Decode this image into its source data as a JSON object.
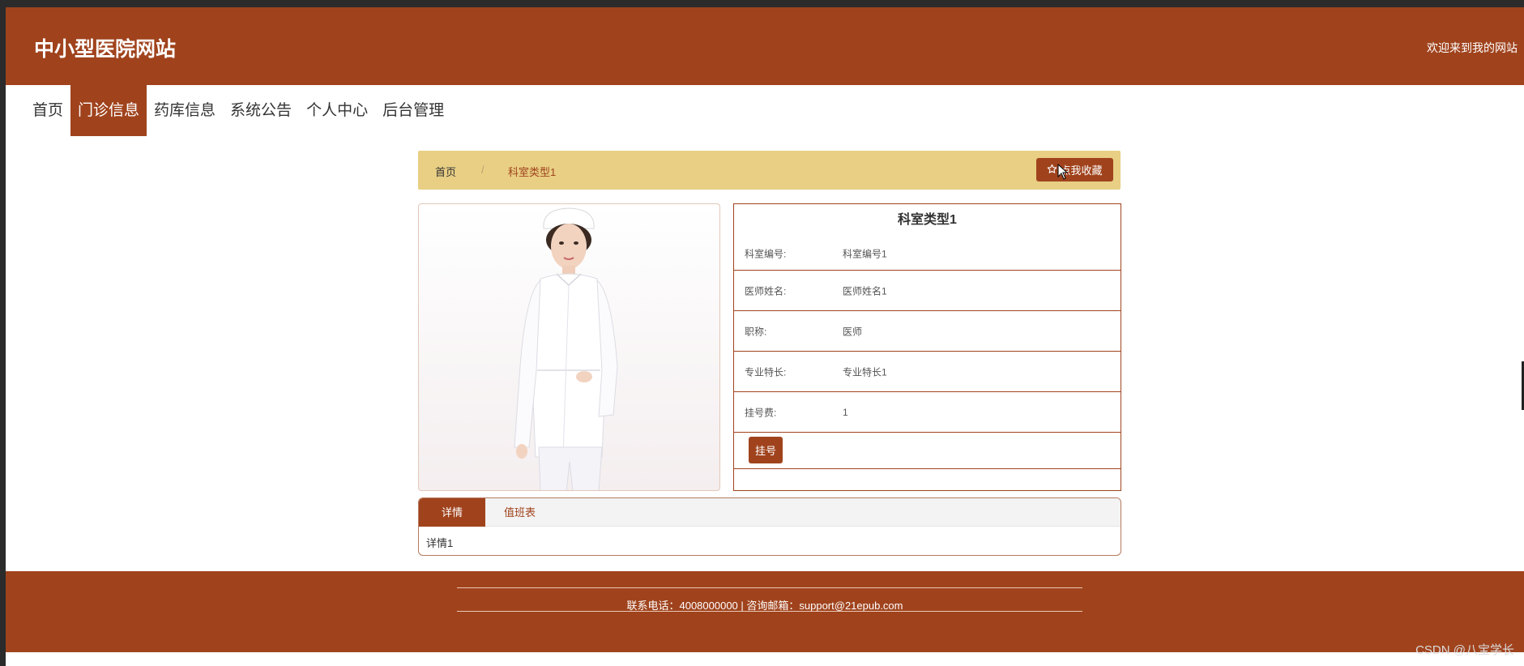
{
  "header": {
    "site_title": "中小型医院网站",
    "welcome_text": "欢迎来到我的网站"
  },
  "nav": {
    "items": [
      {
        "label": "首页"
      },
      {
        "label": "门诊信息"
      },
      {
        "label": "药库信息"
      },
      {
        "label": "系统公告"
      },
      {
        "label": "个人中心"
      },
      {
        "label": "后台管理"
      }
    ],
    "active": "门诊信息"
  },
  "breadcrumb": {
    "home": "首页",
    "separator": "/",
    "current": "科室类型1",
    "favorite_label": "点我收藏",
    "favorite_icon": "star-outline-icon"
  },
  "detail": {
    "title": "科室类型1",
    "fields": [
      {
        "label": "科室编号:",
        "value": "科室编号1"
      },
      {
        "label": "医师姓名:",
        "value": "医师姓名1"
      },
      {
        "label": "职称:",
        "value": "医师"
      },
      {
        "label": "专业特长:",
        "value": "专业特长1"
      },
      {
        "label": "挂号费:",
        "value": "1"
      }
    ],
    "register_label": "挂号"
  },
  "tabs": {
    "items": [
      {
        "label": "详情"
      },
      {
        "label": "值班表"
      }
    ],
    "active": "详情",
    "content": "详情1"
  },
  "footer": {
    "contact": "联系电话：4008000000 | 咨询邮箱：support@21epub.com"
  },
  "watermark": "CSDN @八宝学长",
  "colors": {
    "brand": "#a0431d",
    "breadcrumb_bg": "#e8cf84",
    "page_bg": "#ffffff"
  }
}
